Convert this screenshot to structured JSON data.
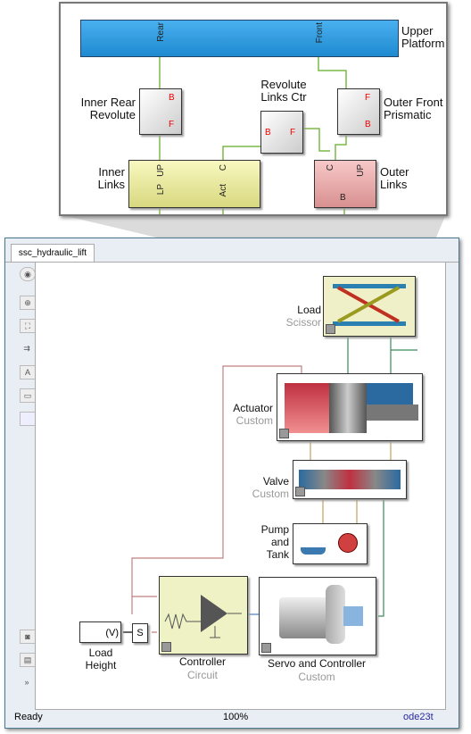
{
  "inset": {
    "upper_platform": {
      "label": "Upper\nPlatform",
      "ports": [
        "Rear",
        "Front"
      ]
    },
    "inner_rear_revolute": {
      "label": "Inner Rear\nRevolute",
      "ports": [
        "B",
        "F"
      ]
    },
    "revolute_links_ctr": {
      "label": "Revolute\nLinks Ctr",
      "ports": [
        "B",
        "F"
      ]
    },
    "outer_front_prismatic": {
      "label": "Outer Front\nPrismatic",
      "ports": [
        "F",
        "B"
      ]
    },
    "inner_links": {
      "label": "Inner\nLinks",
      "ports": [
        "UP",
        "C",
        "LP",
        "Act"
      ]
    },
    "outer_links": {
      "label": "Outer\nLinks",
      "ports": [
        "C",
        "UP",
        "B"
      ]
    }
  },
  "window": {
    "tab": "ssc_hydraulic_lift"
  },
  "toolbar": {
    "icons": [
      "hide-browser-icon",
      "zoom-icon",
      "fit-view-icon",
      "arrows-icon",
      "annotation-icon",
      "image-icon",
      "area-icon",
      "screenshot-icon",
      "model-browser-icon",
      "more-icon"
    ],
    "more": "»"
  },
  "blocks": {
    "load": {
      "name": "Load",
      "type": "Scissor"
    },
    "actuator": {
      "name": "Actuator",
      "type": "Custom"
    },
    "valve": {
      "name": "Valve",
      "type": "Custom"
    },
    "pump": {
      "name": "Pump\nand\nTank"
    },
    "controller": {
      "name": "Controller",
      "type": "Circuit"
    },
    "servo": {
      "name": "Servo and Controller",
      "type": "Custom"
    },
    "load_height": {
      "name": "Load\nHeight",
      "unit": "(V)"
    },
    "s_block": {
      "label": "S"
    }
  },
  "status": {
    "state": "Ready",
    "zoom": "100%",
    "solver": "ode23t"
  },
  "colors": {
    "physical_wire": "#3a8a5a",
    "signal_wire": "#c08080",
    "electrical_wire": "#4a7acc",
    "hydraulic_wire": "#c0a060",
    "mech_wire": "#7cba48"
  }
}
